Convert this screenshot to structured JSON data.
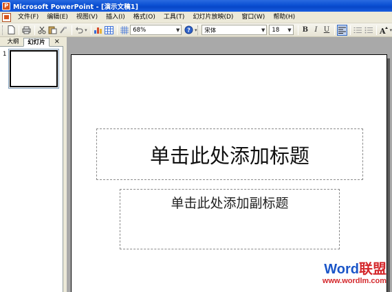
{
  "window": {
    "title": "Microsoft PowerPoint - [演示文稿1]",
    "app_icon": "powerpoint-icon"
  },
  "menubar": {
    "items": [
      "文件(F)",
      "编辑(E)",
      "视图(V)",
      "插入(I)",
      "格式(O)",
      "工具(T)",
      "幻灯片放映(D)",
      "窗口(W)",
      "帮助(H)"
    ]
  },
  "toolbar": {
    "zoom": "68%",
    "font": "宋体",
    "font_size": "18",
    "bold_label": "B",
    "italic_label": "I",
    "underline_label": "U"
  },
  "left_pane": {
    "tabs": [
      "大纲",
      "幻灯片"
    ],
    "close_label": "×",
    "thumbnails": [
      {
        "number": "1"
      }
    ]
  },
  "slide": {
    "title_placeholder": "单击此处添加标题",
    "subtitle_placeholder": "单击此处添加副标题"
  },
  "watermark": {
    "logo_word": "Word",
    "logo_cn": "联盟",
    "url": "www.wordlm.com"
  },
  "colors": {
    "titlebar": "#0a4fd3",
    "chrome": "#ece9d8",
    "workspace": "#a9a9a9",
    "watermark_blue": "#1a55c8",
    "watermark_red": "#d4272b"
  }
}
